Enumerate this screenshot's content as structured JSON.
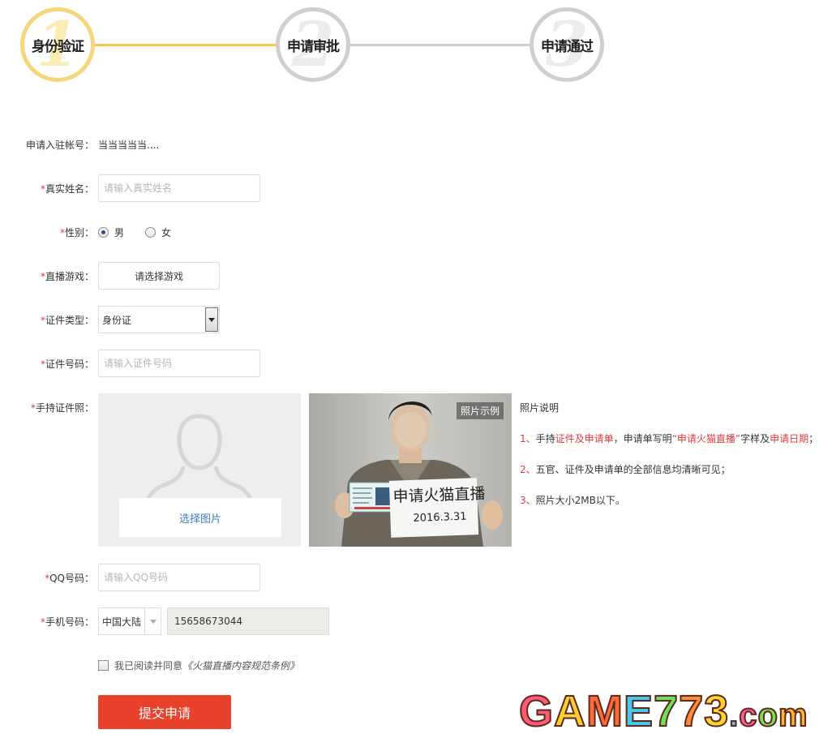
{
  "stepper": {
    "steps": [
      {
        "num": "1",
        "label": "身份验证"
      },
      {
        "num": "2",
        "label": "申请审批"
      },
      {
        "num": "3",
        "label": "申请通过"
      }
    ],
    "active_index": 0,
    "colors": {
      "active": "#f7d679",
      "inactive": "#cfcfcf"
    }
  },
  "form": {
    "account": {
      "label": "申请入驻帐号：",
      "value": "当当当当当...."
    },
    "real_name": {
      "required_mark": "*",
      "label": "真实姓名：",
      "placeholder": "请输入真实姓名"
    },
    "gender": {
      "required_mark": "*",
      "label": "性别：",
      "options": [
        "男",
        "女"
      ],
      "selected": "男"
    },
    "game": {
      "required_mark": "*",
      "label": "直播游戏：",
      "button": "请选择游戏"
    },
    "id_type": {
      "required_mark": "*",
      "label": "证件类型：",
      "selected": "身份证"
    },
    "id_number": {
      "required_mark": "*",
      "label": "证件号码：",
      "placeholder": "请输入证件号码"
    },
    "photo": {
      "required_mark": "*",
      "label": "手持证件照：",
      "upload_button": "选择图片",
      "example_badge": "照片示例",
      "example_sign": {
        "line1": "申请火猫直播",
        "line2": "2016.3.31"
      }
    },
    "photo_notes": {
      "title": "照片说明",
      "lines": [
        {
          "num": "1、",
          "parts": [
            "手持",
            "证件及申请单",
            "，申请单写明",
            "“申请火猫直播”",
            "字样及",
            "申请日期",
            "；"
          ]
        },
        {
          "num": "2、",
          "text": "五官、证件及申请单的全部信息均清晰可见；"
        },
        {
          "num": "3、",
          "text": "照片大小2MB以下。"
        }
      ]
    },
    "qq": {
      "required_mark": "*",
      "label": "QQ号码：",
      "placeholder": "请输入QQ号码"
    },
    "phone": {
      "required_mark": "*",
      "label": "手机号码：",
      "region": "中国大陆",
      "value": "15658673044"
    },
    "agreement": {
      "text": "我已阅读并同意",
      "doc": "《火猫直播内容规范条例》"
    },
    "submit": "提交申请",
    "colors": {
      "required": "#e4393c",
      "submit": "#e8412c",
      "link": "#3a7fc4"
    }
  },
  "watermark": {
    "text": "GAME773.com"
  }
}
